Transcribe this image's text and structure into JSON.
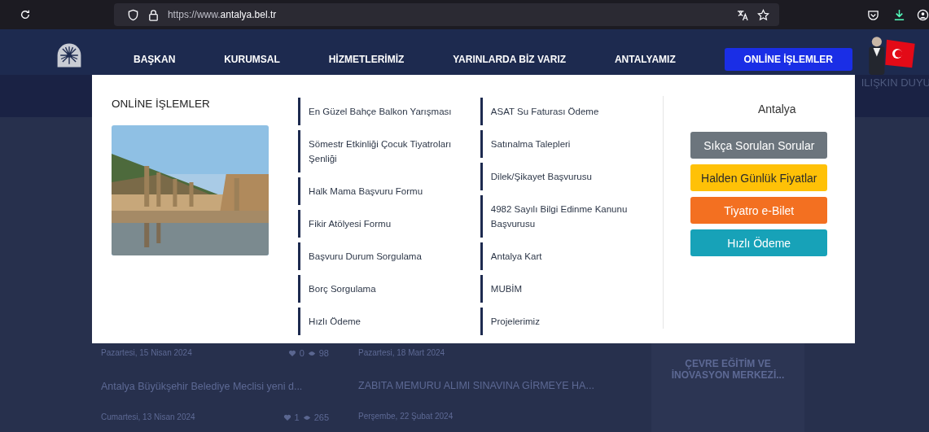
{
  "browser": {
    "url_host": "https://www.",
    "url_domain": "antalya.bel.tr"
  },
  "nav": {
    "items": [
      {
        "label": "BAŞKAN",
        "selected": false
      },
      {
        "label": "KURUMSAL",
        "selected": false
      },
      {
        "label": "HİZMETLERİMİZ",
        "selected": false
      },
      {
        "label": "YARINLARDA BİZ VARIZ",
        "selected": false
      },
      {
        "label": "ANTALYAMIZ",
        "selected": false
      },
      {
        "label": "ONLİNE İŞLEMLER",
        "selected": true
      }
    ]
  },
  "background": {
    "banner": "ILIŞKIN DUYU",
    "news": [
      {
        "date": "Pazartesi, 15 Nisan 2024",
        "likes": "0",
        "views": "98",
        "title": "Antalya Büyükşehir Belediye Meclisi yeni d...",
        "date2": "Cumartesi, 13 Nisan 2024",
        "likes2": "1",
        "views2": "265"
      },
      {
        "date": "Pazartesi, 18 Mart 2024",
        "title": "ZABITA MEMURU ALIMI SINAVINA GİRMEYE HA...",
        "date2": "Perşembe, 22 Şubat 2024"
      }
    ],
    "card_title": "ÇEVRE EĞİTİM VE İNOVASYON MERKEZİ..."
  },
  "menu": {
    "title": "ONLİNE İŞLEMLER",
    "columns": [
      [
        "En Güzel Bahçe Balkon Yarışması",
        "Sömestr Etkinliği Çocuk Tiyatroları Şenliği",
        "Halk Mama Başvuru Formu",
        "Fikir Atölyesi Formu",
        "Başvuru Durum Sorgulama",
        "Borç Sorgulama",
        "Hızlı Ödeme"
      ],
      [
        "ASAT Su Faturası Ödeme",
        "Satınalma Talepleri",
        "Dilek/Şikayet Başvurusu",
        "4982 Sayılı Bilgi Edinme Kanunu Başvurusu",
        "Antalya Kart",
        "MUBİM",
        "Projelerimiz"
      ]
    ],
    "side_title": "Antalya",
    "buttons": [
      {
        "label": "Sıkça Sorulan Sorular",
        "color": "#6c757d"
      },
      {
        "label": "Halden Günlük Fiyatlar",
        "color": "#ffc107"
      },
      {
        "label": "Tiyatro e-Bilet",
        "color": "#f37021"
      },
      {
        "label": "Hızlı Ödeme",
        "color": "#17a2b8"
      }
    ]
  }
}
